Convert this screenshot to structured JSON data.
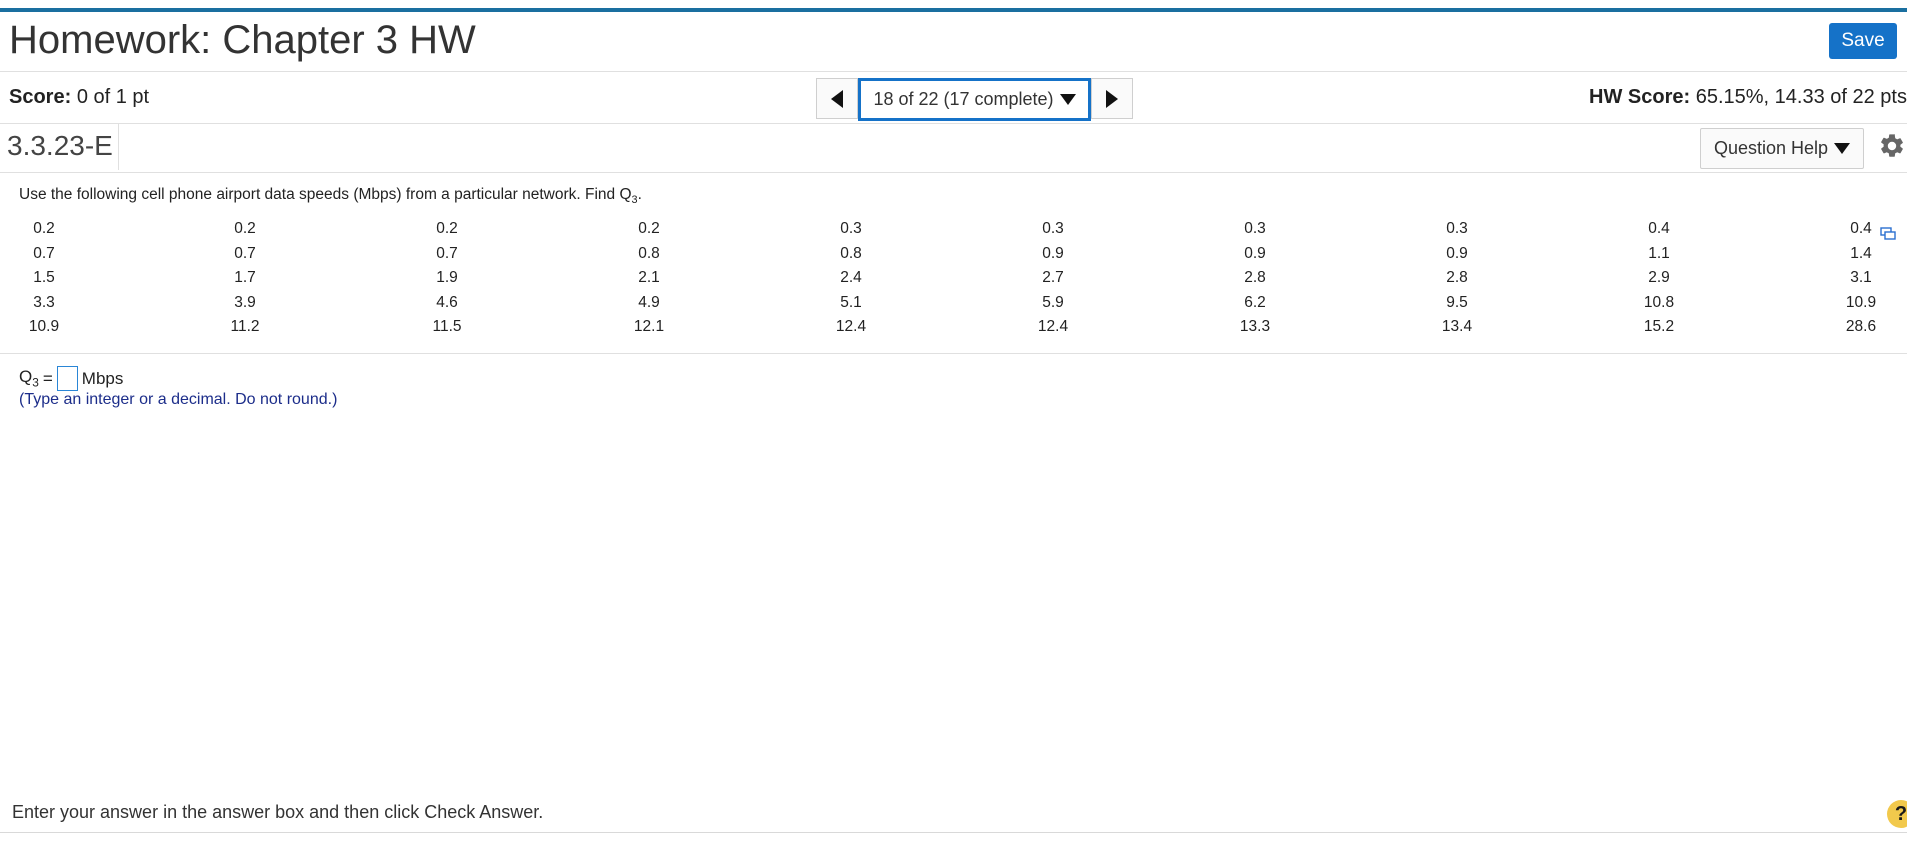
{
  "header": {
    "title": "Homework: Chapter 3 HW",
    "save_label": "Save"
  },
  "status": {
    "score_label": "Score:",
    "score_value": "0 of 1 pt",
    "question_nav": "18 of 22 (17 complete)",
    "hw_score_label": "HW Score:",
    "hw_score_value": "65.15%, 14.33 of 22 pts"
  },
  "question_bar": {
    "id": "3.3.23-E",
    "help_label": "Question Help"
  },
  "question": {
    "text": "Use the following cell phone airport data speeds (Mbps) from a particular network. Find Q",
    "sub": "3",
    "period": "."
  },
  "data_table": [
    [
      "0.2",
      "0.2",
      "0.2",
      "0.2",
      "0.3",
      "0.3",
      "0.3",
      "0.3",
      "0.4",
      "0.4"
    ],
    [
      "0.7",
      "0.7",
      "0.7",
      "0.8",
      "0.8",
      "0.9",
      "0.9",
      "0.9",
      "1.1",
      "1.4"
    ],
    [
      "1.5",
      "1.7",
      "1.9",
      "2.1",
      "2.4",
      "2.7",
      "2.8",
      "2.8",
      "2.9",
      "3.1"
    ],
    [
      "3.3",
      "3.9",
      "4.6",
      "4.9",
      "5.1",
      "5.9",
      "6.2",
      "9.5",
      "10.8",
      "10.9"
    ],
    [
      "10.9",
      "11.2",
      "11.5",
      "12.1",
      "12.4",
      "12.4",
      "13.3",
      "13.4",
      "15.2",
      "28.6"
    ]
  ],
  "answer": {
    "label": "Q",
    "sub": "3",
    "equals": "=",
    "unit": "Mbps",
    "value": "",
    "hint": "(Type an integer or a decimal. Do not round.)"
  },
  "footer": {
    "instruction": "Enter your answer in the answer box and then click Check Answer.",
    "help_symbol": "?"
  },
  "colors": {
    "accent": "#1572c8",
    "top_bar": "#1a6fa0",
    "hint_text": "#1c2d8a"
  }
}
